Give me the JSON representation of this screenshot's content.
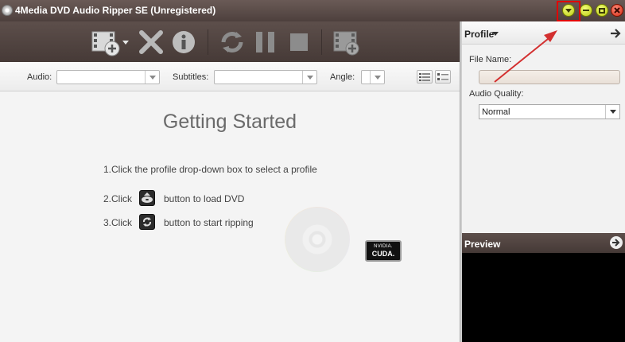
{
  "titlebar": {
    "title": "4Media DVD Audio Ripper SE (Unregistered)",
    "buttons": [
      "dropdown",
      "minimize",
      "maximize",
      "close"
    ]
  },
  "toolbar": {
    "icons": [
      "add-file-icon",
      "remove-icon",
      "info-icon",
      "convert-icon",
      "pause-icon",
      "stop-icon",
      "add-segment-icon"
    ]
  },
  "options": {
    "audio_label": "Audio:",
    "audio_value": "",
    "subtitles_label": "Subtitles:",
    "subtitles_value": "",
    "angle_label": "Angle:",
    "angle_value": ""
  },
  "getting_started": {
    "title": "Getting Started",
    "step1": "1.Click the profile drop-down box to select a profile",
    "step2_prefix": "2.Click",
    "step2_suffix": "button to load DVD",
    "step3_prefix": "3.Click",
    "step3_suffix": "button to start ripping",
    "badge_line1": "NVIDIA.",
    "badge_line2": "CUDA."
  },
  "profile_panel": {
    "title": "Profile",
    "file_name_label": "File Name:",
    "file_name_value": "",
    "audio_quality_label": "Audio Quality:",
    "audio_quality_value": "Normal"
  },
  "preview_panel": {
    "title": "Preview"
  },
  "colors": {
    "annotation": "#d32f2f",
    "titlebar": "#4d403d",
    "toolbar": "#463a37"
  }
}
